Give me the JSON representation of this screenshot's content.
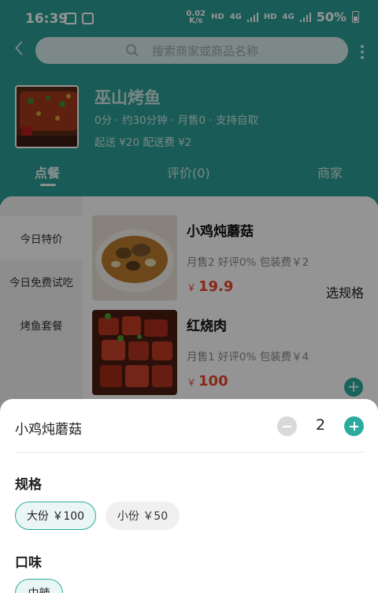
{
  "status_bar": {
    "time": "16:39",
    "net_speed_top": "0.02",
    "net_speed_bottom": "K/s",
    "hd1": "HD",
    "lte1": "4G",
    "hd2": "HD",
    "lte2": "4G",
    "battery": "50%"
  },
  "search": {
    "placeholder": "搜索商家或商品名称"
  },
  "shop": {
    "name": "巫山烤鱼",
    "meta": "0分 · 约30分钟 · 月售0 · 支持自取",
    "fees": "起送 ¥20 配送费 ¥2"
  },
  "tabs": [
    {
      "label": "点餐",
      "active": true
    },
    {
      "label": "评价(0)"
    },
    {
      "label": "商家"
    }
  ],
  "categories": [
    {
      "label": "今日特价"
    },
    {
      "label": "今日免费试吃"
    },
    {
      "label": "烤鱼套餐"
    }
  ],
  "products": [
    {
      "name": "小鸡炖蘑菇",
      "stats": "月售2  好评0%  包装费￥2",
      "currency": "￥",
      "price": "19.9",
      "action": "选规格"
    },
    {
      "name": "红烧肉",
      "stats": "月售1  好评0%  包装费￥4",
      "currency": "￥",
      "price": "100",
      "action_icon": "plus-icon"
    }
  ],
  "sheet": {
    "title": "小鸡炖蘑菇",
    "quantity": "2",
    "spec_label": "规格",
    "spec_options": [
      {
        "label": "大份 ￥100",
        "selected": true
      },
      {
        "label": "小份 ￥50",
        "selected": false
      }
    ],
    "flavor_label": "口味",
    "flavor_options": [
      {
        "label": "中辣",
        "selected": true
      }
    ]
  },
  "colors": {
    "header": "#2b9e95",
    "accent": "#2bab9d",
    "price": "#e8482b"
  }
}
